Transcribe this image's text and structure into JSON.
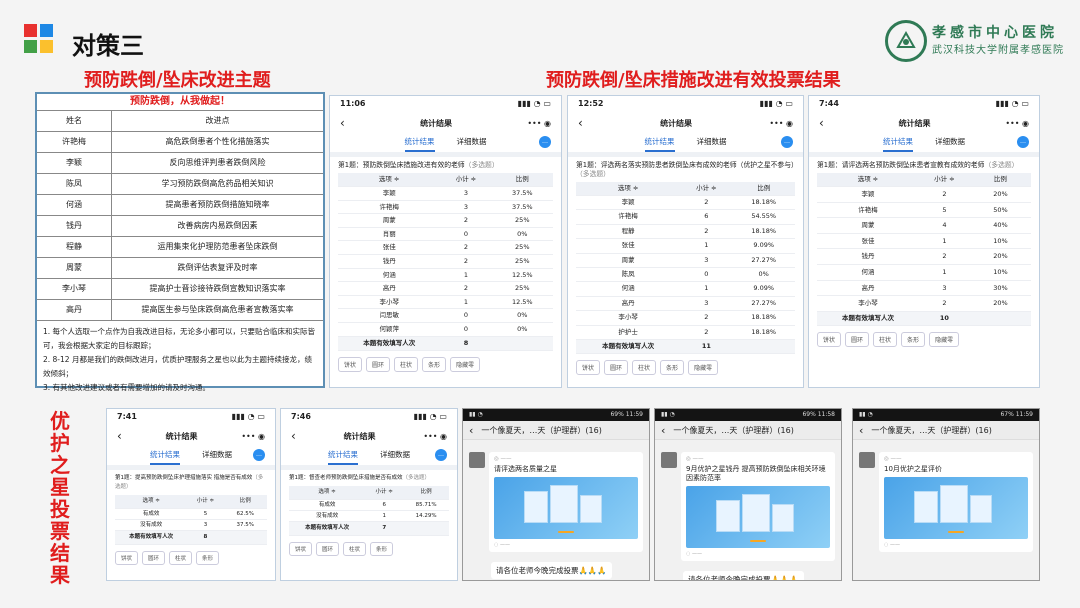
{
  "slide": {
    "title": "对策三",
    "logo_colors": [
      "#e8312f",
      "#1e88e5",
      "#43a047",
      "#fbc02d"
    ]
  },
  "hospital": {
    "name": "孝感市中心医院",
    "subname": "武汉科技大学附属孝感医院"
  },
  "sections": {
    "left_title": "预防跌倒/坠床改进主题",
    "right_title": "预防跌倒/坠床措施改进有效投票结果",
    "bottom_title": "优护之星投票结果"
  },
  "theme_table": {
    "heading": "预防跌倒，从我做起！",
    "col_name": "姓名",
    "col_point": "改进点",
    "rows": [
      {
        "name": "许艳梅",
        "point": "高危跌倒患者个性化措施落实"
      },
      {
        "name": "李颖",
        "point": "反向思维评判患者跌倒风险"
      },
      {
        "name": "陈凤",
        "point": "学习预防跌倒高危药品相关知识"
      },
      {
        "name": "何涵",
        "point": "提高患者预防跌倒措施知晓率"
      },
      {
        "name": "钱丹",
        "point": "改善病房内易跌倒因素"
      },
      {
        "name": "程静",
        "point": "运用集束化护理防范患者坠床跌倒"
      },
      {
        "name": "周蒙",
        "point": "跌倒评估表复评及时率"
      },
      {
        "name": "李小琴",
        "point": "提高护士晋诊接待跌倒宣教知识落实率"
      },
      {
        "name": "高丹",
        "point": "提高医生参与坠床跌倒高危患者宣教落实率"
      }
    ],
    "notes": [
      "1. 每个人选取一个点作为自我改进目标，无论多小都可以，只要贴合临床和实际皆可，我会根据大家定的目标跟踪；",
      "2. 8-12 月都是我们的跌倒改进月，优质护理服务之星也以此为主题持续接龙，绩效倾斜；",
      "3. 有其他改进建议或者有需要增加的请及时沟通。"
    ]
  },
  "vote_common": {
    "nav_title": "统计结果",
    "tab_result": "统计结果",
    "tab_detail": "详细数据",
    "multi_tag": "（多选题）",
    "col_option": "选项 ≑",
    "col_count": "小计 ≑",
    "col_ratio": "比例",
    "total_label": "本题有效填写人次",
    "buttons": [
      "饼状",
      "圆环",
      "柱状",
      "条形",
      "隐藏零"
    ]
  },
  "phones_top": [
    {
      "time": "11:06",
      "question": "第1题：预防跌倒坠床措施改进有效的老师",
      "rows": [
        {
          "o": "李颖",
          "c": "3",
          "r": "37.5%"
        },
        {
          "o": "许艳梅",
          "c": "3",
          "r": "37.5%"
        },
        {
          "o": "周蒙",
          "c": "2",
          "r": "25%"
        },
        {
          "o": "肖丽",
          "c": "0",
          "r": "0%"
        },
        {
          "o": "张佳",
          "c": "2",
          "r": "25%"
        },
        {
          "o": "钱丹",
          "c": "2",
          "r": "25%"
        },
        {
          "o": "何涵",
          "c": "1",
          "r": "12.5%"
        },
        {
          "o": "高丹",
          "c": "2",
          "r": "25%"
        },
        {
          "o": "李小琴",
          "c": "1",
          "r": "12.5%"
        },
        {
          "o": "闫思敏",
          "c": "0",
          "r": "0%"
        },
        {
          "o": "何颖萍",
          "c": "0",
          "r": "0%"
        }
      ],
      "total": "8"
    },
    {
      "time": "12:52",
      "question": "第1题：评选两名落实预防患者跌倒坠床有成效的老师（优护之星不参与）",
      "rows": [
        {
          "o": "李颖",
          "c": "2",
          "r": "18.18%"
        },
        {
          "o": "许艳梅",
          "c": "6",
          "r": "54.55%"
        },
        {
          "o": "程静",
          "c": "2",
          "r": "18.18%"
        },
        {
          "o": "张佳",
          "c": "1",
          "r": "9.09%"
        },
        {
          "o": "周蒙",
          "c": "3",
          "r": "27.27%"
        },
        {
          "o": "陈凤",
          "c": "0",
          "r": "0%"
        },
        {
          "o": "何涵",
          "c": "1",
          "r": "9.09%"
        },
        {
          "o": "高丹",
          "c": "3",
          "r": "27.27%"
        },
        {
          "o": "李小琴",
          "c": "2",
          "r": "18.18%"
        },
        {
          "o": "护护士",
          "c": "2",
          "r": "18.18%"
        }
      ],
      "total": "11"
    },
    {
      "time": "7:44",
      "question": "第1题：请评选两名预防跌倒坠床患者宣教有成效的老师",
      "rows": [
        {
          "o": "李颖",
          "c": "2",
          "r": "20%"
        },
        {
          "o": "许艳梅",
          "c": "5",
          "r": "50%"
        },
        {
          "o": "周蒙",
          "c": "4",
          "r": "40%"
        },
        {
          "o": "张佳",
          "c": "1",
          "r": "10%"
        },
        {
          "o": "钱丹",
          "c": "2",
          "r": "20%"
        },
        {
          "o": "何涵",
          "c": "1",
          "r": "10%"
        },
        {
          "o": "高丹",
          "c": "3",
          "r": "30%"
        },
        {
          "o": "李小琴",
          "c": "2",
          "r": "20%"
        }
      ],
      "total": "10"
    }
  ],
  "phones_bottom": [
    {
      "time": "7:41",
      "question": "第1题：提高预防跌倒坠床护理措施落实 措施是否有成效",
      "rows": [
        {
          "o": "有成效",
          "c": "5",
          "r": "62.5%"
        },
        {
          "o": "没有成效",
          "c": "3",
          "r": "37.5%"
        }
      ],
      "total": "8"
    },
    {
      "time": "7:46",
      "question": "第1题：督查老师预防跌倒坠床措施是否有成效",
      "rows": [
        {
          "o": "有成效",
          "c": "6",
          "r": "85.71%"
        },
        {
          "o": "没有成效",
          "c": "1",
          "r": "14.29%"
        }
      ],
      "total": "7"
    }
  ],
  "chats": [
    {
      "status_right": "69% 11:59",
      "title": "一个像夏天，…天（护理群）(16)",
      "card_title": "请评选两名质量之星",
      "bubble": "请各位老师今晚完成投票🙏🙏🙏"
    },
    {
      "status_right": "69% 11:58",
      "title": "一个像夏天，…天（护理群）(16)",
      "card_title": "9月优护之星钱丹 提高预防跌倒坠床相关环境因素防范率",
      "bubble": "请各位老师今晚完成投票🙏🙏🙏"
    },
    {
      "status_right": "67% 11:59",
      "title": "一个像夏天，…天（护理群）(16)",
      "card_title": "10月优护之星评价",
      "bubble": ""
    }
  ]
}
